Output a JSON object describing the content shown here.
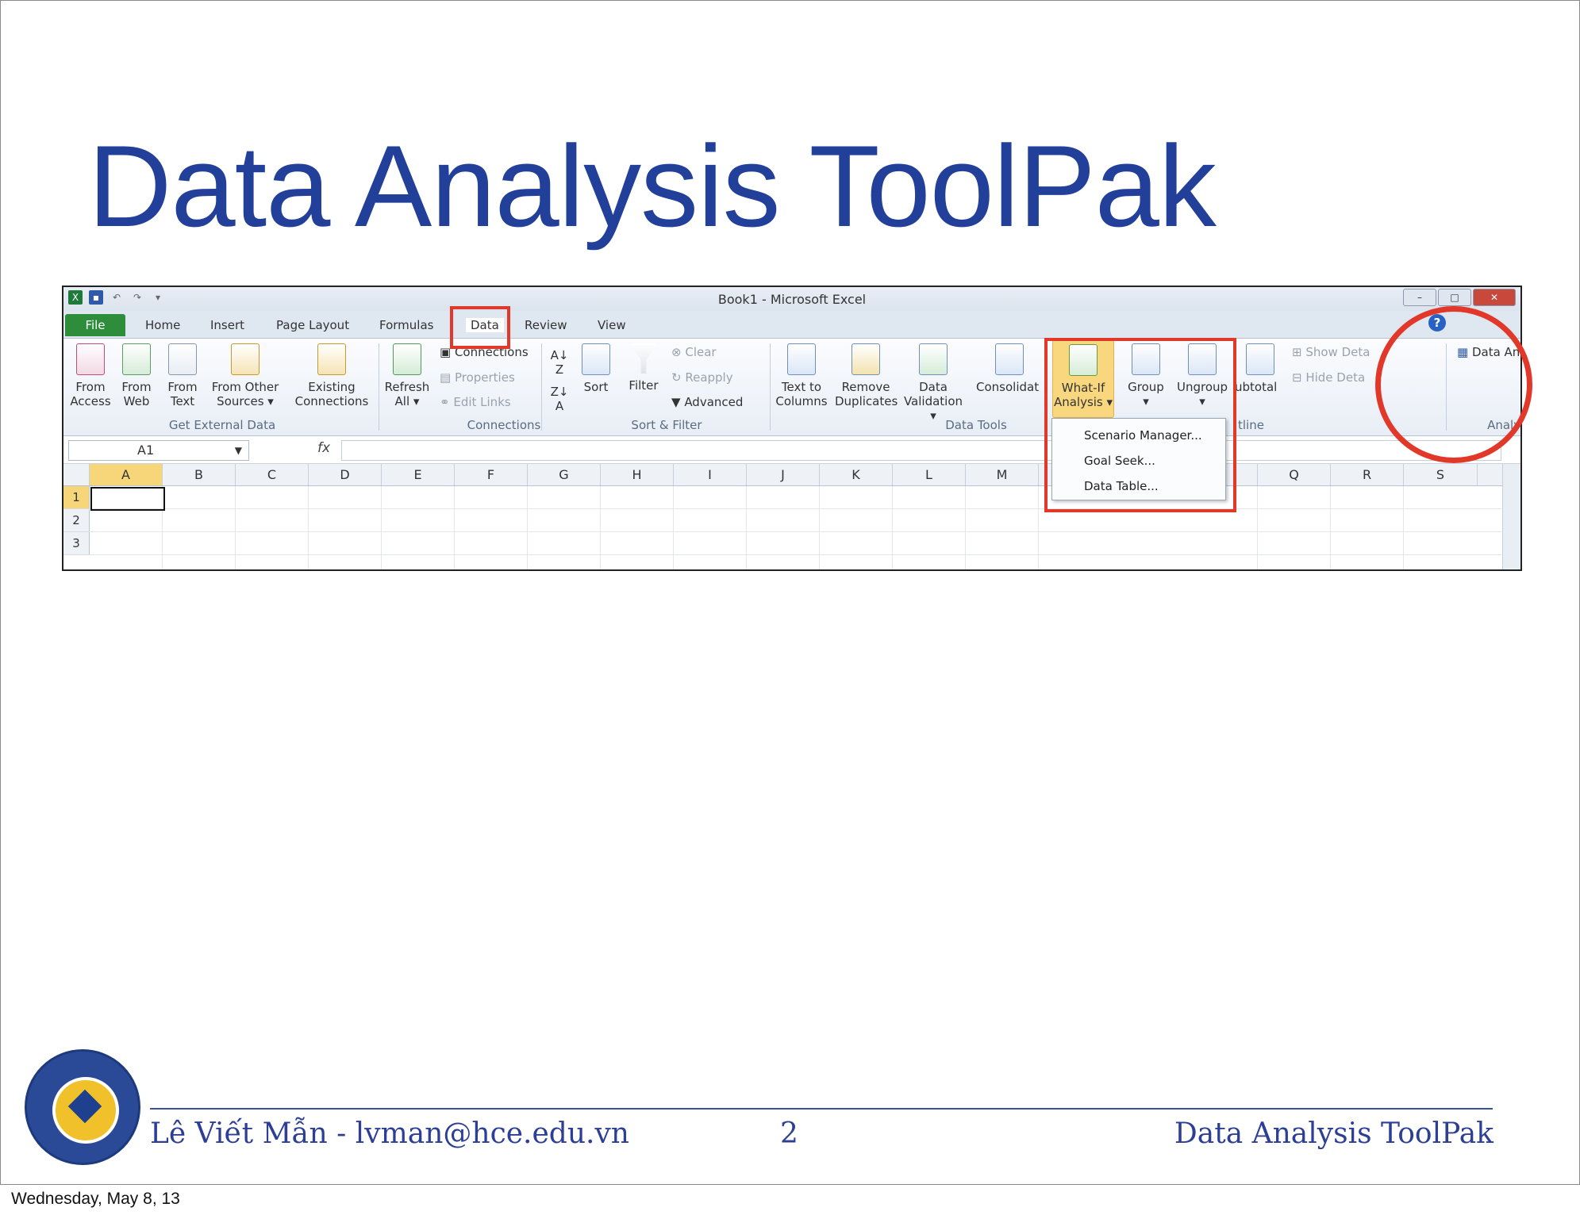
{
  "slide": {
    "title": "Data Analysis ToolPak",
    "footer": {
      "author_prefix": "Lê Viết Mẫn - ",
      "email": "lvman@hce.edu.vn",
      "page": "2",
      "right_title": "Data Analysis ToolPak"
    },
    "date": "Wednesday, May 8, 13"
  },
  "excel": {
    "window_title": "Book1  -  Microsoft Excel",
    "tabs": [
      "File",
      "Home",
      "Insert",
      "Page Layout",
      "Formulas",
      "Data",
      "Review",
      "View"
    ],
    "ribbon": {
      "get_external": {
        "from_access": [
          "From",
          "Access"
        ],
        "from_web": [
          "From",
          "Web"
        ],
        "from_text": [
          "From",
          "Text"
        ],
        "from_other": [
          "From Other",
          "Sources ▾"
        ],
        "existing": [
          "Existing",
          "Connections"
        ],
        "group": "Get External Data"
      },
      "connections": {
        "refresh": [
          "Refresh",
          "All ▾"
        ],
        "connections": "Connections",
        "properties": "Properties",
        "edit_links": "Edit Links",
        "group": "Connections"
      },
      "sort_filter": {
        "sort": "Sort",
        "filter": "Filter",
        "clear": "Clear",
        "reapply": "Reapply",
        "advanced": "Advanced",
        "group": "Sort & Filter"
      },
      "data_tools": {
        "text_to_columns": [
          "Text to",
          "Columns"
        ],
        "remove_duplicates": [
          "Remove",
          "Duplicates"
        ],
        "data_validation": [
          "Data",
          "Validation ▾"
        ],
        "consolidate": "Consolidat",
        "what_if": [
          "What-If",
          "Analysis ▾"
        ],
        "group": "Data Tools"
      },
      "outline": {
        "group_btn": "Group",
        "ungroup_btn": "Ungroup",
        "subtotal": "ubtotal",
        "show_detail": "Show Deta",
        "hide_detail": "Hide Deta",
        "group": "tline"
      },
      "analysis": {
        "data_analysis": "Data Analysis",
        "group": "Analysis"
      }
    },
    "name_box": "A1",
    "fx": "fx",
    "columns": [
      "A",
      "B",
      "C",
      "D",
      "E",
      "F",
      "G",
      "H",
      "I",
      "J",
      "K",
      "L",
      "M",
      "Q",
      "R",
      "S"
    ],
    "rows": [
      "1",
      "2",
      "3"
    ],
    "whatif_menu": [
      "Scenario Manager...",
      "Goal Seek...",
      "Data Table..."
    ]
  },
  "colors": {
    "title": "#22409a",
    "highlight": "#e2382a",
    "file_tab": "#2e8d3a",
    "selected_header": "#f7d679"
  }
}
